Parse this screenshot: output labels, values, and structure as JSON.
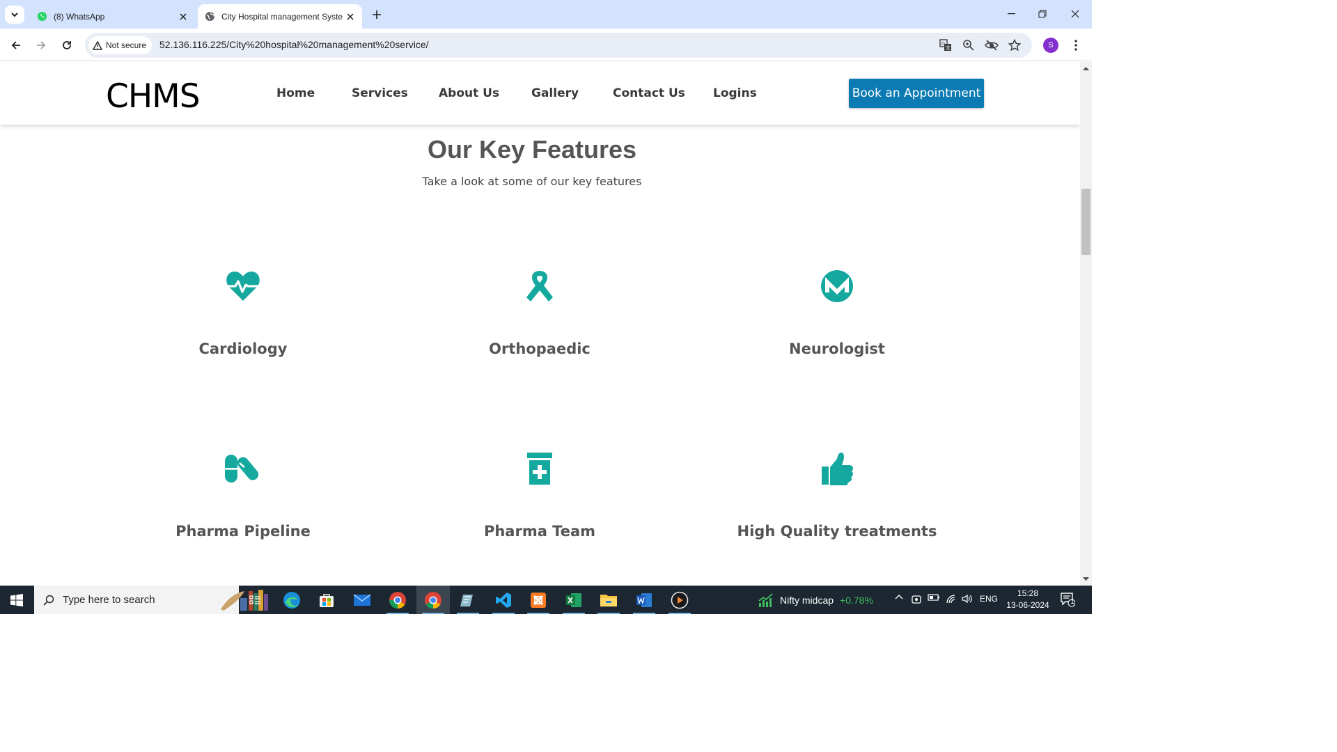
{
  "browser": {
    "tabs": [
      {
        "title": "(8) WhatsApp",
        "favicon": "whatsapp-icon",
        "active": false
      },
      {
        "title": "City Hospital management System",
        "favicon": "globe-icon",
        "active": true
      }
    ],
    "security_label": "Not secure",
    "url": "52.136.116.225/City%20hospital%20management%20service/",
    "profile_initial": "S"
  },
  "site": {
    "logo": "CHMS",
    "nav": [
      "Home",
      "Services",
      "About Us",
      "Gallery",
      "Contact Us",
      "Logins"
    ],
    "cta": "Book an Appointment",
    "accent_color": "#14a89e",
    "cta_color": "#0c7bb3"
  },
  "section": {
    "title": "Our Key Features",
    "subtitle": "Take a look at some of our key features",
    "features": [
      {
        "label": "Cardiology",
        "icon": "heartbeat-icon"
      },
      {
        "label": "Orthopaedic",
        "icon": "ribbon-icon"
      },
      {
        "label": "Neurologist",
        "icon": "monero-icon"
      },
      {
        "label": "Pharma Pipeline",
        "icon": "pills-icon"
      },
      {
        "label": "Pharma Team",
        "icon": "prescription-bottle-icon"
      },
      {
        "label": "High Quality treatments",
        "icon": "thumbs-up-icon"
      }
    ]
  },
  "taskbar": {
    "search_placeholder": "Type here to search",
    "widget_name": "Nifty midcap",
    "widget_change": "+0.78%",
    "language": "ENG",
    "time": "15:28",
    "date": "13-06-2024",
    "notification_count": "1"
  }
}
